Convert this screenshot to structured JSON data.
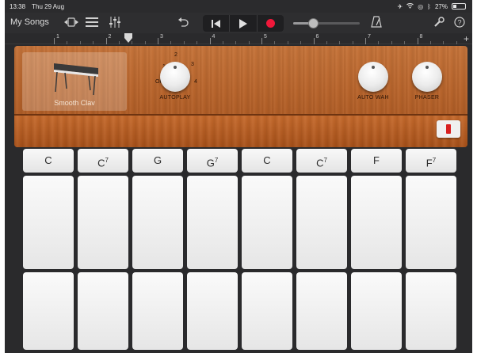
{
  "status_bar": {
    "time": "13:38",
    "date": "Thu 29 Aug",
    "battery": "27%",
    "battery_level": 0.27
  },
  "toolbar": {
    "my_songs": "My Songs",
    "volume_level": 0.3
  },
  "ruler": {
    "bars": [
      "1",
      "2",
      "3",
      "4",
      "5",
      "6",
      "7",
      "8"
    ]
  },
  "instrument": {
    "name": "Smooth Clav"
  },
  "autoplay": {
    "label": "AUTOPLAY",
    "positions": [
      "OFF",
      "1",
      "2",
      "3",
      "4"
    ],
    "value": "1"
  },
  "effects": [
    {
      "label": "AUTO WAH"
    },
    {
      "label": "PHASER"
    }
  ],
  "chords": [
    {
      "root": "C",
      "ext": ""
    },
    {
      "root": "C",
      "ext": "7"
    },
    {
      "root": "G",
      "ext": ""
    },
    {
      "root": "G",
      "ext": "7"
    },
    {
      "root": "C",
      "ext": ""
    },
    {
      "root": "C",
      "ext": "7"
    },
    {
      "root": "F",
      "ext": ""
    },
    {
      "root": "F",
      "ext": "7"
    }
  ],
  "colors": {
    "record": "#f0183a",
    "wood": "#b9652c",
    "arpeggiator": "#d82020"
  }
}
